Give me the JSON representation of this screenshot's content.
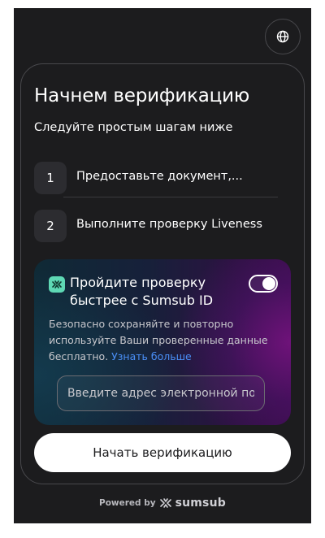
{
  "header": {
    "language_icon": "globe-icon"
  },
  "card": {
    "title": "Начнем верификацию",
    "subtitle": "Следуйте простым шагам ниже",
    "steps": [
      {
        "number": "1",
        "label": "Предоставьте документ,..."
      },
      {
        "number": "2",
        "label": "Выполните проверку Liveness"
      }
    ]
  },
  "promo": {
    "logo_icon": "sumsub-id-logo-icon",
    "title": "Пройдите проверку быстрее с Sumsub ID",
    "toggle_on": true,
    "description": "Безопасно сохраняйте и повторно используйте Ваши проверенные данные бесплатно.",
    "link_label": "Узнать больше",
    "email_placeholder": "Введите адрес электронной почты",
    "email_value": ""
  },
  "actions": {
    "start_label": "Начать верификацию"
  },
  "footer": {
    "powered_label": "Powered by",
    "brand_name": "sumsub",
    "brand_icon": "sumsub-logo-icon"
  },
  "colors": {
    "background": "#1c1c1e",
    "card_border": "#48484c",
    "accent_link": "#4a8ff7",
    "logo_green": "#5ed8b4",
    "button_bg": "#ffffff"
  }
}
